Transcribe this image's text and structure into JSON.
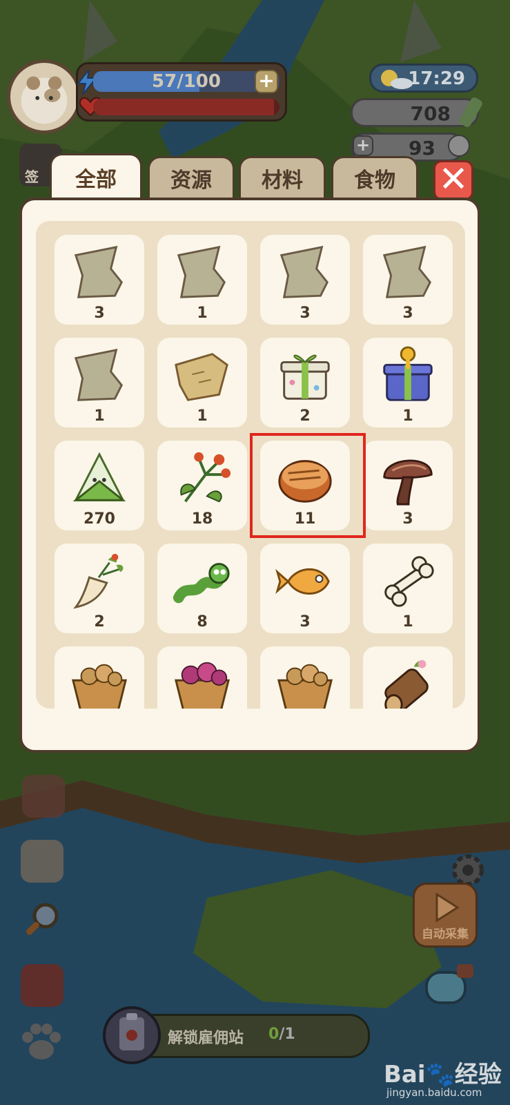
{
  "hud": {
    "energy": "57/100",
    "energy_fraction": 0.57,
    "hp_fraction": 0.97,
    "time": "17:29",
    "coins": "708",
    "pearls": "93",
    "signin_label": "签"
  },
  "bag": {
    "tabs": [
      {
        "label": "全部",
        "active": true
      },
      {
        "label": "资源",
        "active": false
      },
      {
        "label": "材料",
        "active": false
      },
      {
        "label": "食物",
        "active": false
      }
    ],
    "close_label": "✕",
    "items": [
      {
        "icon": "map-fragment-icon",
        "count": "3"
      },
      {
        "icon": "map-fragment-icon",
        "count": "1"
      },
      {
        "icon": "map-fragment-icon",
        "count": "3"
      },
      {
        "icon": "map-fragment-icon",
        "count": "3"
      },
      {
        "icon": "map-fragment-icon",
        "count": "1"
      },
      {
        "icon": "treasure-map-icon",
        "count": "1"
      },
      {
        "icon": "gift-box-icon",
        "count": "2"
      },
      {
        "icon": "gift-box-key-icon",
        "count": "1"
      },
      {
        "icon": "rice-dumpling-icon",
        "count": "270"
      },
      {
        "icon": "berry-herb-icon",
        "count": "18"
      },
      {
        "icon": "grilled-meat-icon",
        "count": "11"
      },
      {
        "icon": "mushroom-icon",
        "count": "3"
      },
      {
        "icon": "ginseng-icon",
        "count": "2"
      },
      {
        "icon": "worm-icon",
        "count": "8"
      },
      {
        "icon": "fish-icon",
        "count": "3"
      },
      {
        "icon": "bone-icon",
        "count": "1"
      },
      {
        "icon": "potato-basket-icon",
        "count": ""
      },
      {
        "icon": "flower-basket-icon",
        "count": ""
      },
      {
        "icon": "potato-basket-icon",
        "count": ""
      },
      {
        "icon": "wood-log-icon",
        "count": ""
      }
    ]
  },
  "bottom": {
    "auto_collect_label": "自动采集",
    "task_label": "解锁雇佣站",
    "task_done": "0",
    "task_total": "/1"
  },
  "watermark": {
    "brand": "Bai🐾经验",
    "url": "jingyan.baidu.com"
  }
}
